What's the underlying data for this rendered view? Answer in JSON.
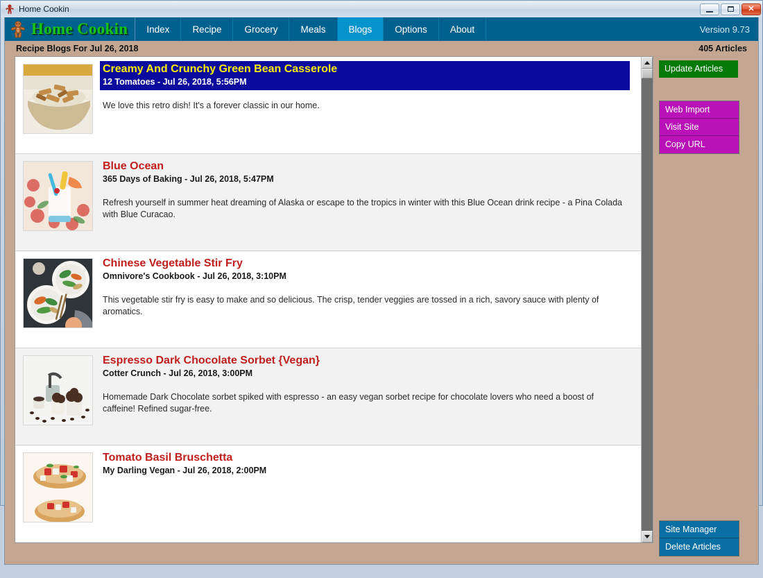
{
  "window": {
    "title": "Home Cookin",
    "icon": "gingerbread-man-icon",
    "buttons": {
      "minimize": "–",
      "maximize": "□",
      "close": "✕"
    }
  },
  "menubar": {
    "brand": "Home Cookin",
    "brand_icon": "gingerbread-man-icon",
    "items": [
      {
        "label": "Index",
        "active": false
      },
      {
        "label": "Recipe",
        "active": false
      },
      {
        "label": "Grocery",
        "active": false
      },
      {
        "label": "Meals",
        "active": false
      },
      {
        "label": "Blogs",
        "active": true
      },
      {
        "label": "Options",
        "active": false
      },
      {
        "label": "About",
        "active": false
      }
    ],
    "version": "Version 9.73"
  },
  "subheader": {
    "title": "Recipe Blogs For Jul 26, 2018",
    "count": "405 Articles"
  },
  "articles": [
    {
      "title": "Creamy And Crunchy Green Bean Casserole",
      "meta": "12 Tomatoes - Jul 26, 2018, 5:56PM",
      "description": "We love this retro dish! It's a forever classic in our home.",
      "selected": true,
      "thumb": "green-bean-casserole-bowl-photo"
    },
    {
      "title": "Blue Ocean",
      "meta": "365 Days of Baking - Jul 26, 2018, 5:47PM",
      "description": "Refresh yourself in summer heat dreaming of Alaska or escape to the tropics in winter with this Blue Ocean drink recipe - a Pina Colada with Blue Curacao.",
      "selected": false,
      "thumb": "pina-colada-cocktail-photo"
    },
    {
      "title": "Chinese Vegetable Stir Fry",
      "meta": "Omnivore's Cookbook - Jul 26, 2018, 3:10PM",
      "description": "This vegetable stir fry is easy to make and so delicious. The crisp, tender veggies are tossed in a rich, savory sauce with plenty of aromatics.",
      "selected": false,
      "thumb": "stir-fry-plates-photo"
    },
    {
      "title": "Espresso Dark Chocolate Sorbet {Vegan}",
      "meta": "Cotter Crunch - Jul 26, 2018, 3:00PM",
      "description": "Homemade Dark Chocolate sorbet spiked with espresso - an easy vegan sorbet recipe for chocolate lovers who need a boost of caffeine! Refined sugar-free.",
      "selected": false,
      "thumb": "chocolate-sorbet-cups-photo"
    },
    {
      "title": "Tomato Basil Bruschetta",
      "meta": "My Darling Vegan - Jul 26, 2018, 2:00PM",
      "description": "",
      "selected": false,
      "thumb": "tomato-basil-bruschetta-photo"
    }
  ],
  "sidebar": {
    "update_articles": "Update Articles",
    "web_group": [
      "Web Import",
      "Visit Site",
      "Copy URL"
    ],
    "bottom_group": [
      "Site Manager",
      "Delete Articles"
    ]
  },
  "colors": {
    "menubar": "#00618f",
    "menubar_active": "#0593cc",
    "brand_green": "#16c41a",
    "page_background": "#c3a792",
    "selected_row": "#0b0b9e",
    "selected_title": "#ffee00",
    "title_red": "#c0201d",
    "green_button": "#047a09",
    "purple_button": "#b812b8",
    "blue_button": "#0a6fa3"
  },
  "scrollbar": {
    "up_arrow": "scroll-up-arrow-icon",
    "down_arrow": "scroll-down-arrow-icon"
  }
}
